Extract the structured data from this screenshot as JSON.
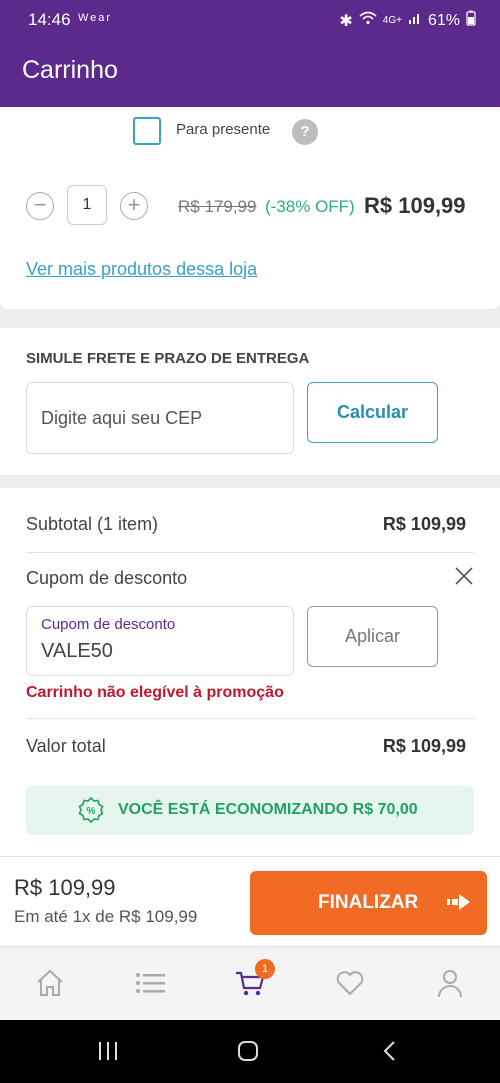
{
  "status_bar": {
    "time": "14:46",
    "left_icons": "Wear",
    "network": "4G+",
    "battery": "61%"
  },
  "header": {
    "title": "Carrinho"
  },
  "product": {
    "gift_label": "Para presente",
    "help_symbol": "?",
    "quantity": "1",
    "old_price": "R$ 179,99",
    "discount": "(-38% OFF)",
    "price": "R$ 109,99",
    "more_link": "Ver mais produtos dessa loja"
  },
  "shipping": {
    "title": "SIMULE FRETE E PRAZO DE ENTREGA",
    "cep_placeholder": "Digite aqui seu CEP",
    "calc_label": "Calcular"
  },
  "totals": {
    "subtotal_label": "Subtotal (1 item)",
    "subtotal_value": "R$ 109,99",
    "coupon_section_label": "Cupom de desconto",
    "coupon_field_label": "Cupom de desconto",
    "coupon_value": "VALE50",
    "apply_label": "Aplicar",
    "error": "Carrinho não elegível à promoção",
    "total_label": "Valor total",
    "total_value": "R$ 109,99",
    "savings": "VOCÊ ESTÁ ECONOMIZANDO R$ 70,00"
  },
  "checkout": {
    "price": "R$ 109,99",
    "installments": "Em até 1x de R$ 109,99",
    "finish_label": "FINALIZAR"
  },
  "bottom_nav": {
    "cart_badge": "1",
    "active": "cart"
  },
  "colors": {
    "brand": "#5b2a8c",
    "accent": "#f26b25",
    "link": "#3aa0c8",
    "success": "#2cae7c",
    "error": "#c0182b"
  }
}
